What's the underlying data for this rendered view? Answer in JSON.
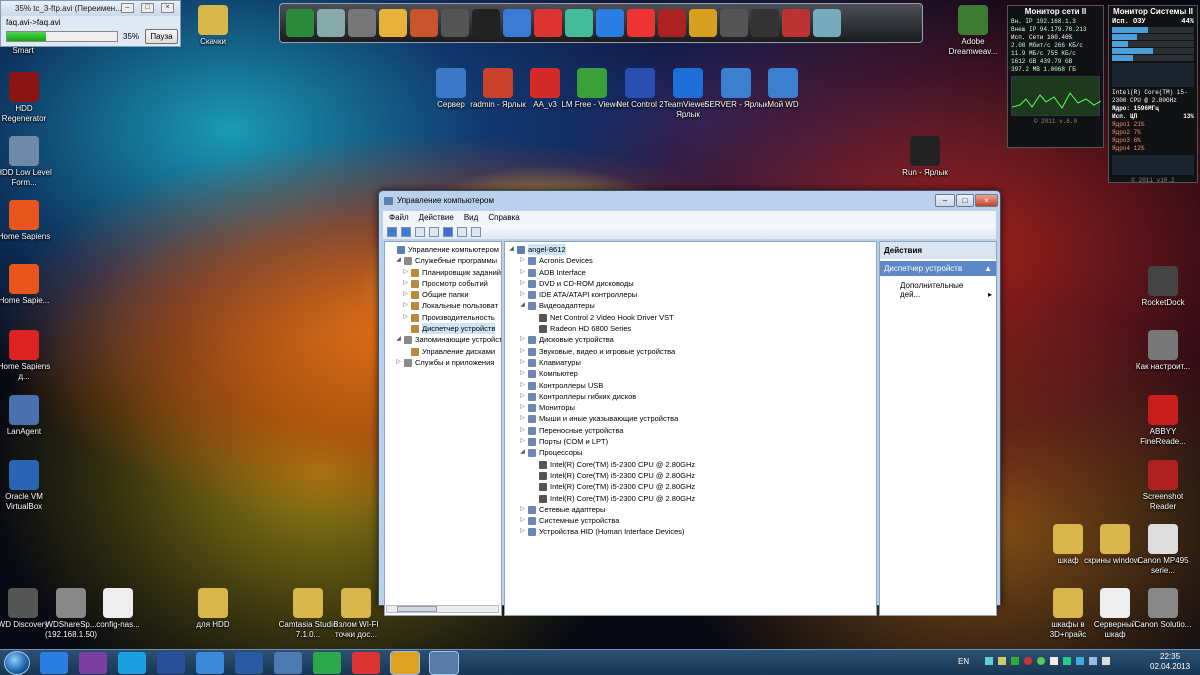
{
  "progress_dialog": {
    "title": "35% tc_3-ftp.avi (Переимен...",
    "path": "faq.avi->faq.avi",
    "percent_label": "35%",
    "percent": 35,
    "pause_label": "Пауза",
    "caption": "Smart"
  },
  "desktop_left": [
    {
      "label": "HDD Regenerator",
      "icon": "hdd-regenerator-icon",
      "color": "#8c1414"
    },
    {
      "label": "HDD Low Level Form...",
      "icon": "hdd-format-icon",
      "color": "#6f8aa6"
    },
    {
      "label": "Home Sapiens",
      "icon": "home-sapiens-icon",
      "color": "#e8561d"
    },
    {
      "label": "Home Sapie...",
      "icon": "home-sapiens-icon",
      "color": "#e8561d"
    },
    {
      "label": "Home Sapiens д...",
      "icon": "home-icon",
      "color": "#d22"
    },
    {
      "label": "LanAgent",
      "icon": "lanagent-icon",
      "color": "#4a70b0"
    },
    {
      "label": "Oracle VM VirtualBox",
      "icon": "virtualbox-icon",
      "color": "#2a64b4"
    }
  ],
  "desktop_top": [
    {
      "label": "Скачки",
      "icon": "folder-icon",
      "color": "#d9b64b"
    },
    {
      "label": "Сервер",
      "icon": "server-icon",
      "color": "#3b78c8"
    },
    {
      "label": "radmin - Ярлык",
      "icon": "radmin-icon",
      "color": "#c8412b"
    },
    {
      "label": "AA_v3",
      "icon": "ammyy-admin-icon",
      "color": "#d32a2a"
    },
    {
      "label": "LM Free - Viewer",
      "icon": "lm-viewer-icon",
      "color": "#3aa03a"
    },
    {
      "label": "Net Control 2",
      "icon": "net-control-icon",
      "color": "#2b4fb0"
    },
    {
      "label": "TeamViewer - Ярлык",
      "icon": "teamviewer-icon",
      "color": "#1d6fd8"
    },
    {
      "label": "SERVER - Ярлык",
      "icon": "monitor-icon",
      "color": "#3a7fd0"
    },
    {
      "label": "Мой WD",
      "icon": "monitor-icon",
      "color": "#3a7fd0"
    },
    {
      "label": "Adobe Dreamweav...",
      "icon": "dreamweaver-icon",
      "color": "#3d7a32"
    },
    {
      "label": "Run - Ярлык",
      "icon": "terminal-icon",
      "color": "#222"
    }
  ],
  "desktop_right": [
    {
      "label": "RocketDock",
      "icon": "rocketdock-icon",
      "color": "#444"
    },
    {
      "label": "Как настроит...",
      "icon": "network-icon",
      "color": "#777"
    },
    {
      "label": "ABBYY FineReade...",
      "icon": "abbyy-icon",
      "color": "#c81e1e"
    },
    {
      "label": "Screenshot Reader",
      "icon": "screenshot-reader-icon",
      "color": "#b02020"
    },
    {
      "label": "шкаф",
      "icon": "folder-icon",
      "color": "#d9b64b"
    },
    {
      "label": "скрины window...",
      "icon": "folder-icon",
      "color": "#d9b64b"
    },
    {
      "label": "Canon MP495 serie...",
      "icon": "printer-icon",
      "color": "#ddd"
    },
    {
      "label": "шкафы в 3D+прайс",
      "icon": "folder-icon",
      "color": "#d9b64b"
    },
    {
      "label": "Серверный шкаф",
      "icon": "document-icon",
      "color": "#eee"
    },
    {
      "label": "Canon Solutio...",
      "icon": "canon-icon",
      "color": "#888"
    }
  ],
  "desktop_bottom": [
    {
      "label": "WD Discovery",
      "icon": "wd-discovery-icon",
      "color": "#555"
    },
    {
      "label": "WDShareSp... (192.168.1.50)",
      "icon": "network-drive-icon",
      "color": "#888"
    },
    {
      "label": "config-nas...",
      "icon": "document-icon",
      "color": "#eee"
    },
    {
      "label": "для HDD",
      "icon": "folder-icon",
      "color": "#d9b64b"
    },
    {
      "label": "Camtasia Studio 7.1.0...",
      "icon": "folder-icon",
      "color": "#d9b64b"
    },
    {
      "label": "Взлом WI-FI точки дос...",
      "icon": "folder-icon",
      "color": "#d9b64b"
    }
  ],
  "dock_icons": [
    "monitor-icon",
    "satellite-icon",
    "tool-icon",
    "rings-icon",
    "photo-icon",
    "pen-icon",
    "folder-icon",
    "wave-icon",
    "camera-icon",
    "maps-icon",
    "play-icon",
    "chrome-icon",
    "radio-icon",
    "warcraft-icon",
    "combat-flight-icon",
    "counter-strike-icon",
    "game-icon",
    "recycle-bin-icon"
  ],
  "net_gadget": {
    "title": "Монитор сети II",
    "rows": [
      "Вн. IP 192.168.1.3",
      "Внеш IP 94.179.78.213",
      "Исп. Сети 100.46%",
      "2.08 Мбит/с 266 КБ/с",
      "11.9 МБ/с 755 КБ/с",
      "1612 GB 439.79 GB",
      "397.2 MB 1.0068 ГБ"
    ],
    "footer": "© 2011 v.8.0"
  },
  "sys_gadget": {
    "title": "Монитор Системы II",
    "mem_label": "Исп. ОЗУ",
    "mem_value": "44%",
    "cpu_name": "Intel(R) Core(TM) i5-2300 CPU @ 2.80GHz",
    "core_freq": "Ядро: 1596МГц",
    "cpu_label": "Исп. ЦП",
    "cpu_value": "13%",
    "cores": [
      "Ядро1 21%",
      "Ядро2 7%",
      "Ядро3 6%",
      "Ядро4 12%"
    ],
    "footer": "© 2011 v10.2"
  },
  "window": {
    "title": "Управление компьютером",
    "menu": [
      "Файл",
      "Действие",
      "Вид",
      "Справка"
    ],
    "left_tree": [
      {
        "label": "Управление компьютером (л",
        "level": 0,
        "exp": ""
      },
      {
        "label": "Служебные программы",
        "level": 1,
        "exp": "◢"
      },
      {
        "label": "Планировщик заданий",
        "level": 2,
        "exp": "▷"
      },
      {
        "label": "Просмотр событий",
        "level": 2,
        "exp": "▷"
      },
      {
        "label": "Общие папки",
        "level": 2,
        "exp": "▷"
      },
      {
        "label": "Локальные пользоват",
        "level": 2,
        "exp": "▷"
      },
      {
        "label": "Производительность",
        "level": 2,
        "exp": "▷"
      },
      {
        "label": "Диспетчер устройств",
        "level": 2,
        "exp": "",
        "selected": true
      },
      {
        "label": "Запоминающие устройст",
        "level": 1,
        "exp": "◢"
      },
      {
        "label": "Управление дисками",
        "level": 2,
        "exp": ""
      },
      {
        "label": "Службы и приложения",
        "level": 1,
        "exp": "▷"
      }
    ],
    "device_tree": [
      {
        "label": "angel-8612",
        "level": 0,
        "exp": "◢",
        "root": true
      },
      {
        "label": "Acronis Devices",
        "level": 1,
        "exp": "▷"
      },
      {
        "label": "ADB Interface",
        "level": 1,
        "exp": "▷"
      },
      {
        "label": "DVD и CD-ROM дисководы",
        "level": 1,
        "exp": "▷"
      },
      {
        "label": "IDE ATA/ATAPI контроллеры",
        "level": 1,
        "exp": "▷"
      },
      {
        "label": "Видеоадаптеры",
        "level": 1,
        "exp": "◢"
      },
      {
        "label": "Net Control 2 Video Hook Driver VST",
        "level": 2,
        "exp": ""
      },
      {
        "label": "Radeon HD 6800 Series",
        "level": 2,
        "exp": ""
      },
      {
        "label": "Дисковые устройства",
        "level": 1,
        "exp": "▷"
      },
      {
        "label": "Звуковые, видео и игровые устройства",
        "level": 1,
        "exp": "▷"
      },
      {
        "label": "Клавиатуры",
        "level": 1,
        "exp": "▷"
      },
      {
        "label": "Компьютер",
        "level": 1,
        "exp": "▷"
      },
      {
        "label": "Контроллеры USB",
        "level": 1,
        "exp": "▷"
      },
      {
        "label": "Контроллеры гибких дисков",
        "level": 1,
        "exp": "▷"
      },
      {
        "label": "Мониторы",
        "level": 1,
        "exp": "▷"
      },
      {
        "label": "Мыши и иные указывающие устройства",
        "level": 1,
        "exp": "▷"
      },
      {
        "label": "Переносные устройства",
        "level": 1,
        "exp": "▷"
      },
      {
        "label": "Порты (COM и LPT)",
        "level": 1,
        "exp": "▷"
      },
      {
        "label": "Процессоры",
        "level": 1,
        "exp": "◢"
      },
      {
        "label": "Intel(R) Core(TM) i5-2300 CPU @ 2.80GHz",
        "level": 2,
        "exp": ""
      },
      {
        "label": "Intel(R) Core(TM) i5-2300 CPU @ 2.80GHz",
        "level": 2,
        "exp": ""
      },
      {
        "label": "Intel(R) Core(TM) i5-2300 CPU @ 2.80GHz",
        "level": 2,
        "exp": ""
      },
      {
        "label": "Intel(R) Core(TM) i5-2300 CPU @ 2.80GHz",
        "level": 2,
        "exp": ""
      },
      {
        "label": "Сетевые адаптеры",
        "level": 1,
        "exp": "▷"
      },
      {
        "label": "Системные устройства",
        "level": 1,
        "exp": "▷"
      },
      {
        "label": "Устройства HID (Human Interface Devices)",
        "level": 1,
        "exp": "▷"
      }
    ],
    "actions": {
      "header": "Действия",
      "section": "Диспетчер устройств",
      "item": "Дополнительные дей..."
    }
  },
  "taskbar": {
    "lang": "EN",
    "time": "22:35",
    "date": "02.04.2013",
    "apps": [
      "ie-icon",
      "media-icon",
      "skype-icon",
      "save-icon",
      "thunder-icon",
      "network-icon",
      "window-icon",
      "mail-icon",
      "chrome-icon",
      "explorer-icon",
      "computer-management-icon"
    ]
  }
}
